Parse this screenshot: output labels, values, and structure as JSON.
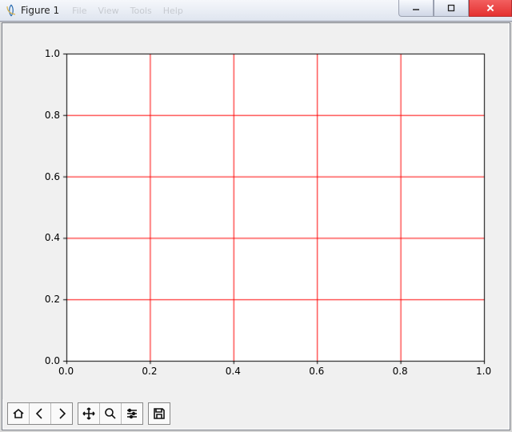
{
  "window": {
    "title": "Figure 1",
    "menu": [
      "File",
      "View",
      "Tools",
      "Help"
    ],
    "buttons": {
      "min": "_",
      "max": "☐",
      "close": "X"
    }
  },
  "toolbar": {
    "home": "Home",
    "back": "Back",
    "forward": "Forward",
    "pan": "Pan",
    "zoom": "Zoom",
    "subplots": "Configure subplots",
    "save": "Save"
  },
  "chart_data": {
    "type": "scatter",
    "title": "",
    "xlabel": "",
    "ylabel": "",
    "xlim": [
      0.0,
      1.0
    ],
    "ylim": [
      0.0,
      1.0
    ],
    "xticks": [
      0.0,
      0.2,
      0.4,
      0.6,
      0.8,
      1.0
    ],
    "yticks": [
      0.0,
      0.2,
      0.4,
      0.6,
      0.8,
      1.0
    ],
    "xtick_labels": [
      "0.0",
      "0.2",
      "0.4",
      "0.6",
      "0.8",
      "1.0"
    ],
    "ytick_labels": [
      "0.0",
      "0.2",
      "0.4",
      "0.6",
      "0.8",
      "1.0"
    ],
    "grid": true,
    "grid_color": "#ff0000",
    "series": []
  }
}
